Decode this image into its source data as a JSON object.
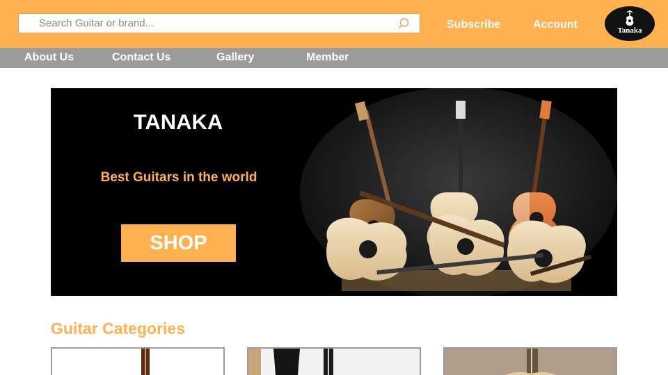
{
  "search": {
    "placeholder": "Search Guitar or brand...",
    "value": ""
  },
  "header": {
    "subscribe_label": "Subscribe",
    "account_label": "Account",
    "logo_text": "Tanaka"
  },
  "nav": {
    "items": [
      {
        "label": "About Us"
      },
      {
        "label": "Contact Us"
      },
      {
        "label": "Gallery"
      },
      {
        "label": "Member"
      }
    ]
  },
  "hero": {
    "title": "TANAKA",
    "subtitle": "Best Guitars in the world",
    "cta_label": "SHOP"
  },
  "categories": {
    "title": "Guitar Categories"
  },
  "colors": {
    "brand_orange": "#ffb04f",
    "nav_gray": "#9b9b9b",
    "hero_bg": "#000000"
  },
  "icons": [
    "search-icon",
    "guitar-logo-icon"
  ]
}
